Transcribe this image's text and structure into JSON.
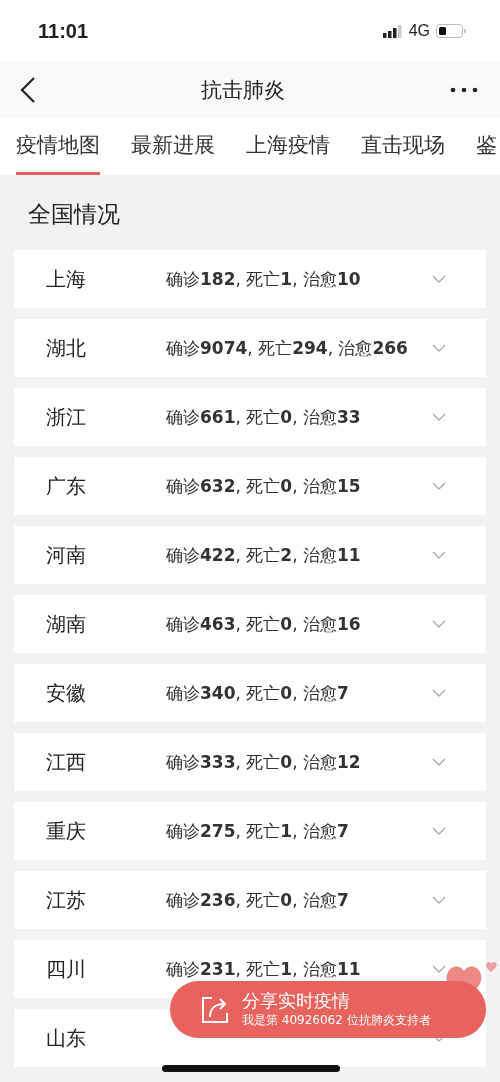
{
  "status_bar": {
    "time": "11:01",
    "network": "4G"
  },
  "nav": {
    "title": "抗击肺炎"
  },
  "tabs": [
    {
      "label": "疫情地图",
      "selected": true
    },
    {
      "label": "最新进展",
      "selected": false
    },
    {
      "label": "上海疫情",
      "selected": false
    },
    {
      "label": "直击现场",
      "selected": false
    },
    {
      "label": "鉴",
      "selected": false
    }
  ],
  "section_title": "全国情况",
  "regions": [
    {
      "name": "上海",
      "stats": "确诊**182**, 死亡**1**, 治愈**10**",
      "expanded": false
    },
    {
      "name": "湖北",
      "stats": "确诊**9074**, 死亡**294**, 治愈**266**",
      "expanded": false
    },
    {
      "name": "浙江",
      "stats": "确诊**661**, 死亡**0**, 治愈**33**",
      "expanded": false
    },
    {
      "name": "广东",
      "stats": "确诊**632**, 死亡**0**, 治愈**15**",
      "expanded": false
    },
    {
      "name": "河南",
      "stats": "确诊**422**, 死亡**2**, 治愈**11**",
      "expanded": false
    },
    {
      "name": "湖南",
      "stats": "确诊**463**, 死亡**0**, 治愈**16**",
      "expanded": false
    },
    {
      "name": "安徽",
      "stats": "确诊**340**, 死亡**0**, 治愈**7**",
      "expanded": false
    },
    {
      "name": "江西",
      "stats": "确诊**333**, 死亡**0**, 治愈**12**",
      "expanded": false
    },
    {
      "name": "重庆",
      "stats": "确诊**275**, 死亡**1**, 治愈**7**",
      "expanded": false
    },
    {
      "name": "江苏",
      "stats": "确诊**236**, 死亡**0**, 治愈**7**",
      "expanded": false
    },
    {
      "name": "四川",
      "stats": "确诊**231**, 死亡**1**, 治愈**11**",
      "expanded": false
    },
    {
      "name": "山东",
      "expanded": false
    }
  ],
  "share": {
    "title": "分享实时疫情",
    "subtitle": "我是第 40926062 位抗肺炎支持者"
  }
}
